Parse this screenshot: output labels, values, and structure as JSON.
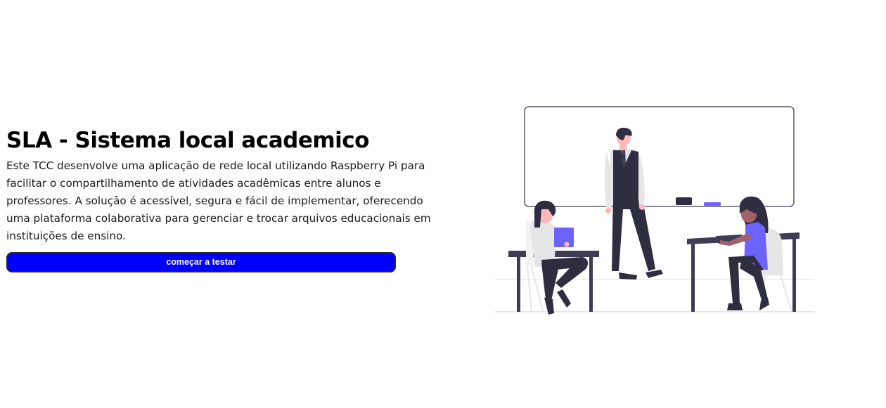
{
  "hero": {
    "title": "SLA - Sistema local academico",
    "description": "Este TCC desenvolve uma aplicação de rede local utilizando Raspberry Pi para facilitar o compartilhamento de atividades acadêmicas entre alunos e professores. A solução é acessível, segura e fácil de implementar, oferecendo uma plataforma colaborativa para gerenciar e trocar arquivos educacionais em instituições de ensino.",
    "cta_label": "começar a testar"
  },
  "illustration": {
    "icon": "classroom-illustration",
    "colors": {
      "accent": "#6c63ff",
      "dark": "#2f2e41",
      "button": "#0000ff"
    }
  }
}
